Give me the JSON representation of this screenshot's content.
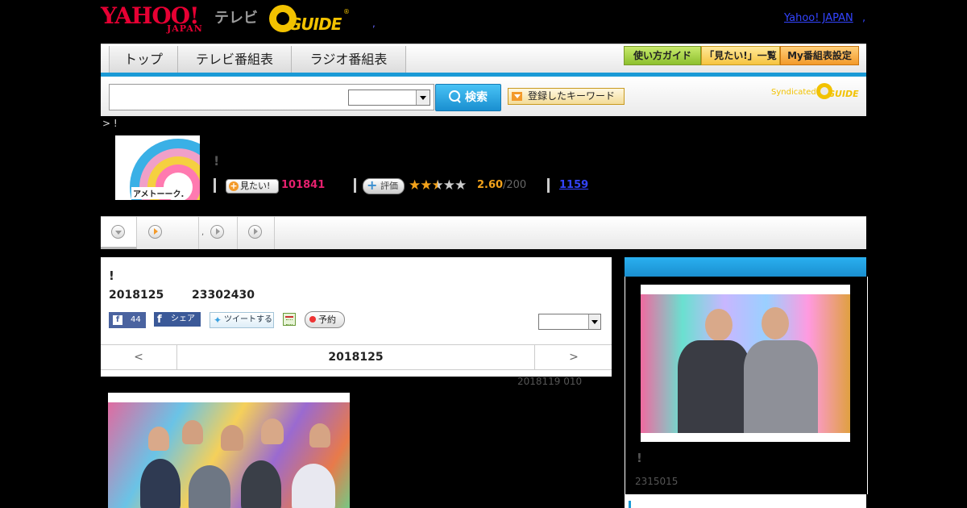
{
  "header": {
    "yahoo_logo_main": "YAHOO!",
    "yahoo_logo_sub": "JAPAN",
    "tv_label": "テレビ",
    "gguide_logo": "GUIDE",
    "dot": ",",
    "yahoo_japan_link": "Yahoo! JAPAN",
    "link_dot": ","
  },
  "nav": {
    "tabs": [
      {
        "label": "トップ"
      },
      {
        "label": "テレビ番組表"
      },
      {
        "label": "ラジオ番組表"
      }
    ],
    "buttons": [
      {
        "label": "使い方ガイド"
      },
      {
        "label": "「見たい!」一覧"
      },
      {
        "label": "My番組表設定"
      }
    ]
  },
  "search": {
    "input_value": "",
    "select_value": "",
    "button_label": "検索",
    "keyword_button_label": "登録したキーワード",
    "syndicated_label": "Syndicated",
    "syndicated_logo": "GUIDE"
  },
  "breadcrumb": "> !",
  "program": {
    "logo_label": "アメトーーク.",
    "title": "!",
    "mitai_label": "見たい!",
    "mitai_count": "101841",
    "eval_label": "評価",
    "stars_filled": 2.5,
    "stars_total": 5,
    "rating": "2.60",
    "rating_denominator": "/200",
    "comments_count": "1159"
  },
  "tabs_strip": {
    "tab2_dot": ","
  },
  "episode": {
    "title": "!",
    "date": "2018125",
    "time": "23302430",
    "fb_like_count": "44",
    "fb_share_label": "シェア",
    "tweet_label": "ツイートする",
    "reserve_label": "予約",
    "select_value": "",
    "pager_prev": "<",
    "pager_date": "2018125",
    "pager_next": ">",
    "update_text": "2018119  010"
  },
  "sidebar": {
    "title": "!",
    "count": "2315015"
  },
  "colors": {
    "accent_blue": "#1a9ad6",
    "brand_red": "#e60033",
    "gguide_yellow": "#f2c200",
    "mitai_pink": "#e6206e",
    "star_orange": "#f3a21a",
    "link_blue": "#3344ff"
  }
}
